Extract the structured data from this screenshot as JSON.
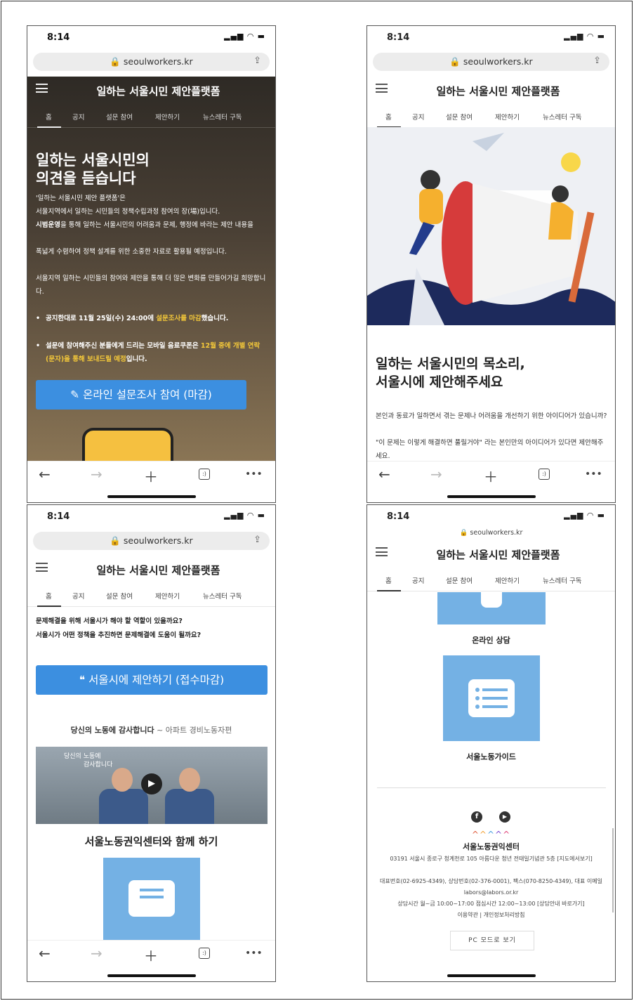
{
  "status": {
    "time": "8:14"
  },
  "browser": {
    "url": "seoulworkers.kr"
  },
  "site": {
    "title": "일하는 서울시민 제안플랫폼",
    "nav": [
      "홈",
      "공지",
      "설문 참여",
      "제안하기",
      "뉴스레터 구독"
    ]
  },
  "screen1": {
    "headline_1": "일하는 서울시민의",
    "headline_2": "의견을 듣습니다",
    "p1": "'일하는 서울시민 제안 플랫폼'은",
    "p2": "서울지역에서 일하는 시민들의 정책수립과정 참여의 장(場)입니다.",
    "p3_bold": "시범운영",
    "p3_rest": "을 통해 일하는 서울시민의 어려움과 문제, 행정에 바라는 제안 내용을",
    "p4": "폭넓게 수렴하여 정책 설계를 위한 소중한 자료로 활용될 예정입니다.",
    "p5": "서울지역 일하는 시민들의 참여와 제안을 통해 더 많은 변화를 만들어가길 희망합니다.",
    "bullet1_a": "공지한대로 11월 25일(수) 24:00에 ",
    "bullet1_b": "설문조사를 마감",
    "bullet1_c": "했습니다.",
    "bullet2_a": "설문에 참여해주신 분들에게 드리는 모바일 음료쿠폰은 ",
    "bullet2_b": "12월 중에 개별 연락(문자)을 통해 보내드릴 예정",
    "bullet2_c": "입니다.",
    "button": "온라인 설문조사 참여 (마감)"
  },
  "screen2": {
    "headline_1": "일하는 서울시민의 목소리,",
    "headline_2": "서울시에 제안해주세요",
    "p1": "본인과 동료가 일하면서 겪는 문제나 어려움을 개선하기 위한 아이디어가 있습니까?",
    "p2": "\"이 문제는 이렇게 해결하면 풀릴거야\" 라는 본인만의 아이디어가 있다면 제안해주세요."
  },
  "screen3": {
    "q1": "문제해결을 위해 서울시가 해야 할 역할이 있을까요?",
    "q2": "서울시가 어떤 정책을 추진하면 문제해결에 도움이 될까요?",
    "button": "서울시에 제안하기 (접수마감)",
    "thanks_bold": "당신의 노동에 감사합니다",
    "thanks_rest": " ~ 아파트 경비노동자편",
    "video_caption_1": "당신의 노동에",
    "video_caption_2": "감사합니다",
    "together": "서울노동권익센터와 함께 하기"
  },
  "screen4": {
    "tile1_label": "온라인 상담",
    "tile2_label": "서울노동가이드",
    "org_name": "서울노동권익센터",
    "addr1": "03191 서울시 종로구 청계천로 105 아름다운 청년 전태일기념관 5층 [지도에서보기]",
    "addr2": "대표번호(02-6925-4349), 상담번호(02-376-0001), 팩스(070-8250-4349), 대표 이메일 labors@labors.or.kr",
    "addr3": "상담시간 월~금 10:00~17:00 점심시간 12:00~13:00 [상담안내 바로가기]",
    "links": "이용약관 | 개인정보처리방침",
    "pc_button": "PC 모드로 보기"
  }
}
